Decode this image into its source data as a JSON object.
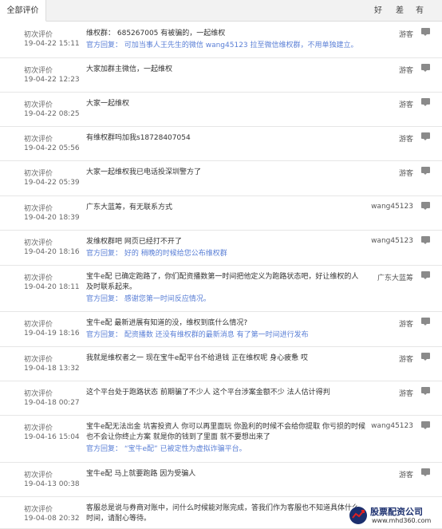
{
  "tabs": {
    "all_reviews": "全部评价"
  },
  "vote_headers": {
    "good": "好",
    "bad": "差",
    "has": "有"
  },
  "reviews": [
    {
      "type": "初次评价",
      "date": "19-04-22 15:11",
      "text": "维权群： 685267005 有被骗的，一起维权",
      "reply": "官方回复： 可加当事人王先生的微信 wang45123 拉至微信维权群，不用单独建立。",
      "author": "游客"
    },
    {
      "type": "初次评价",
      "date": "19-04-22 12:23",
      "text": "大家加群主微信，一起维权",
      "reply": "",
      "author": "游客"
    },
    {
      "type": "初次评价",
      "date": "19-04-22 08:25",
      "text": "大家一起维权",
      "reply": "",
      "author": "游客"
    },
    {
      "type": "初次评价",
      "date": "19-04-22 05:56",
      "text": "有维权群吗加我s18728407054",
      "reply": "",
      "author": "游客"
    },
    {
      "type": "初次评价",
      "date": "19-04-22 05:39",
      "text": "大家一起维权我已电话投深圳警方了",
      "reply": "",
      "author": "游客"
    },
    {
      "type": "初次评价",
      "date": "19-04-20 18:39",
      "text": "广东大蓝筹，有无联系方式",
      "reply": "",
      "author": "wang45123"
    },
    {
      "type": "初次评价",
      "date": "19-04-20 18:16",
      "text": "发维权群吧 网页已经打不开了",
      "reply": "官方回复： 好的 稍晚的时候给您公布维权群",
      "author": "wang45123"
    },
    {
      "type": "初次评价",
      "date": "19-04-20 18:11",
      "text": "宝牛e配 已确定跑路了，你们配资播数第一时间把他定义为跑路状态吧，好让维权的人及时联系起来。",
      "reply": "官方回复： 感谢您第一时间反应情况。",
      "author": "广东大蓝筹"
    },
    {
      "type": "初次评价",
      "date": "19-04-19 18:16",
      "text": "宝牛e配 最新进展有知道的没，维权到底什么情况?",
      "reply": "官方回复： 配资播数 还没有维权群的最新消息 有了第一时间进行发布",
      "author": "游客"
    },
    {
      "type": "初次评价",
      "date": "19-04-18 13:32",
      "text": "我就是维权者之一 现在宝牛e配平台不给退钱 正在维权呢 身心疲惫 哎",
      "reply": "",
      "author": "游客"
    },
    {
      "type": "初次评价",
      "date": "19-04-18 00:27",
      "text": "这个平台处于跑路状态 前期骗了不少人 这个平台涉案金额不少 法人估计得判",
      "reply": "",
      "author": "游客"
    },
    {
      "type": "初次评价",
      "date": "19-04-16 15:04",
      "text": "宝牛e配无法出金 坑害投资人 你可以再里面玩 你盈利的时候不会给你提取 你亏损的时候也不会让你终止方案 就是你的钱到了里面 就不要想出来了",
      "reply": "官方回复： “宝牛e配” 已被定性为虚拟诈骗平台。",
      "author": "wang45123"
    },
    {
      "type": "初次评价",
      "date": "19-04-13 00:38",
      "text": "宝牛e配 马上就要跑路 因为受骗人",
      "reply": "",
      "author": "游客"
    },
    {
      "type": "初次评价",
      "date": "19-04-08 20:32",
      "text": "客服总是说与券商对账中，问什么时候能对账完成，答我们作为客服也不知道具体什么时间，请耐心等待。",
      "reply": "",
      "author": ""
    }
  ],
  "watermark": {
    "title": "股票配资公司",
    "url": "www.mhd360.com"
  }
}
